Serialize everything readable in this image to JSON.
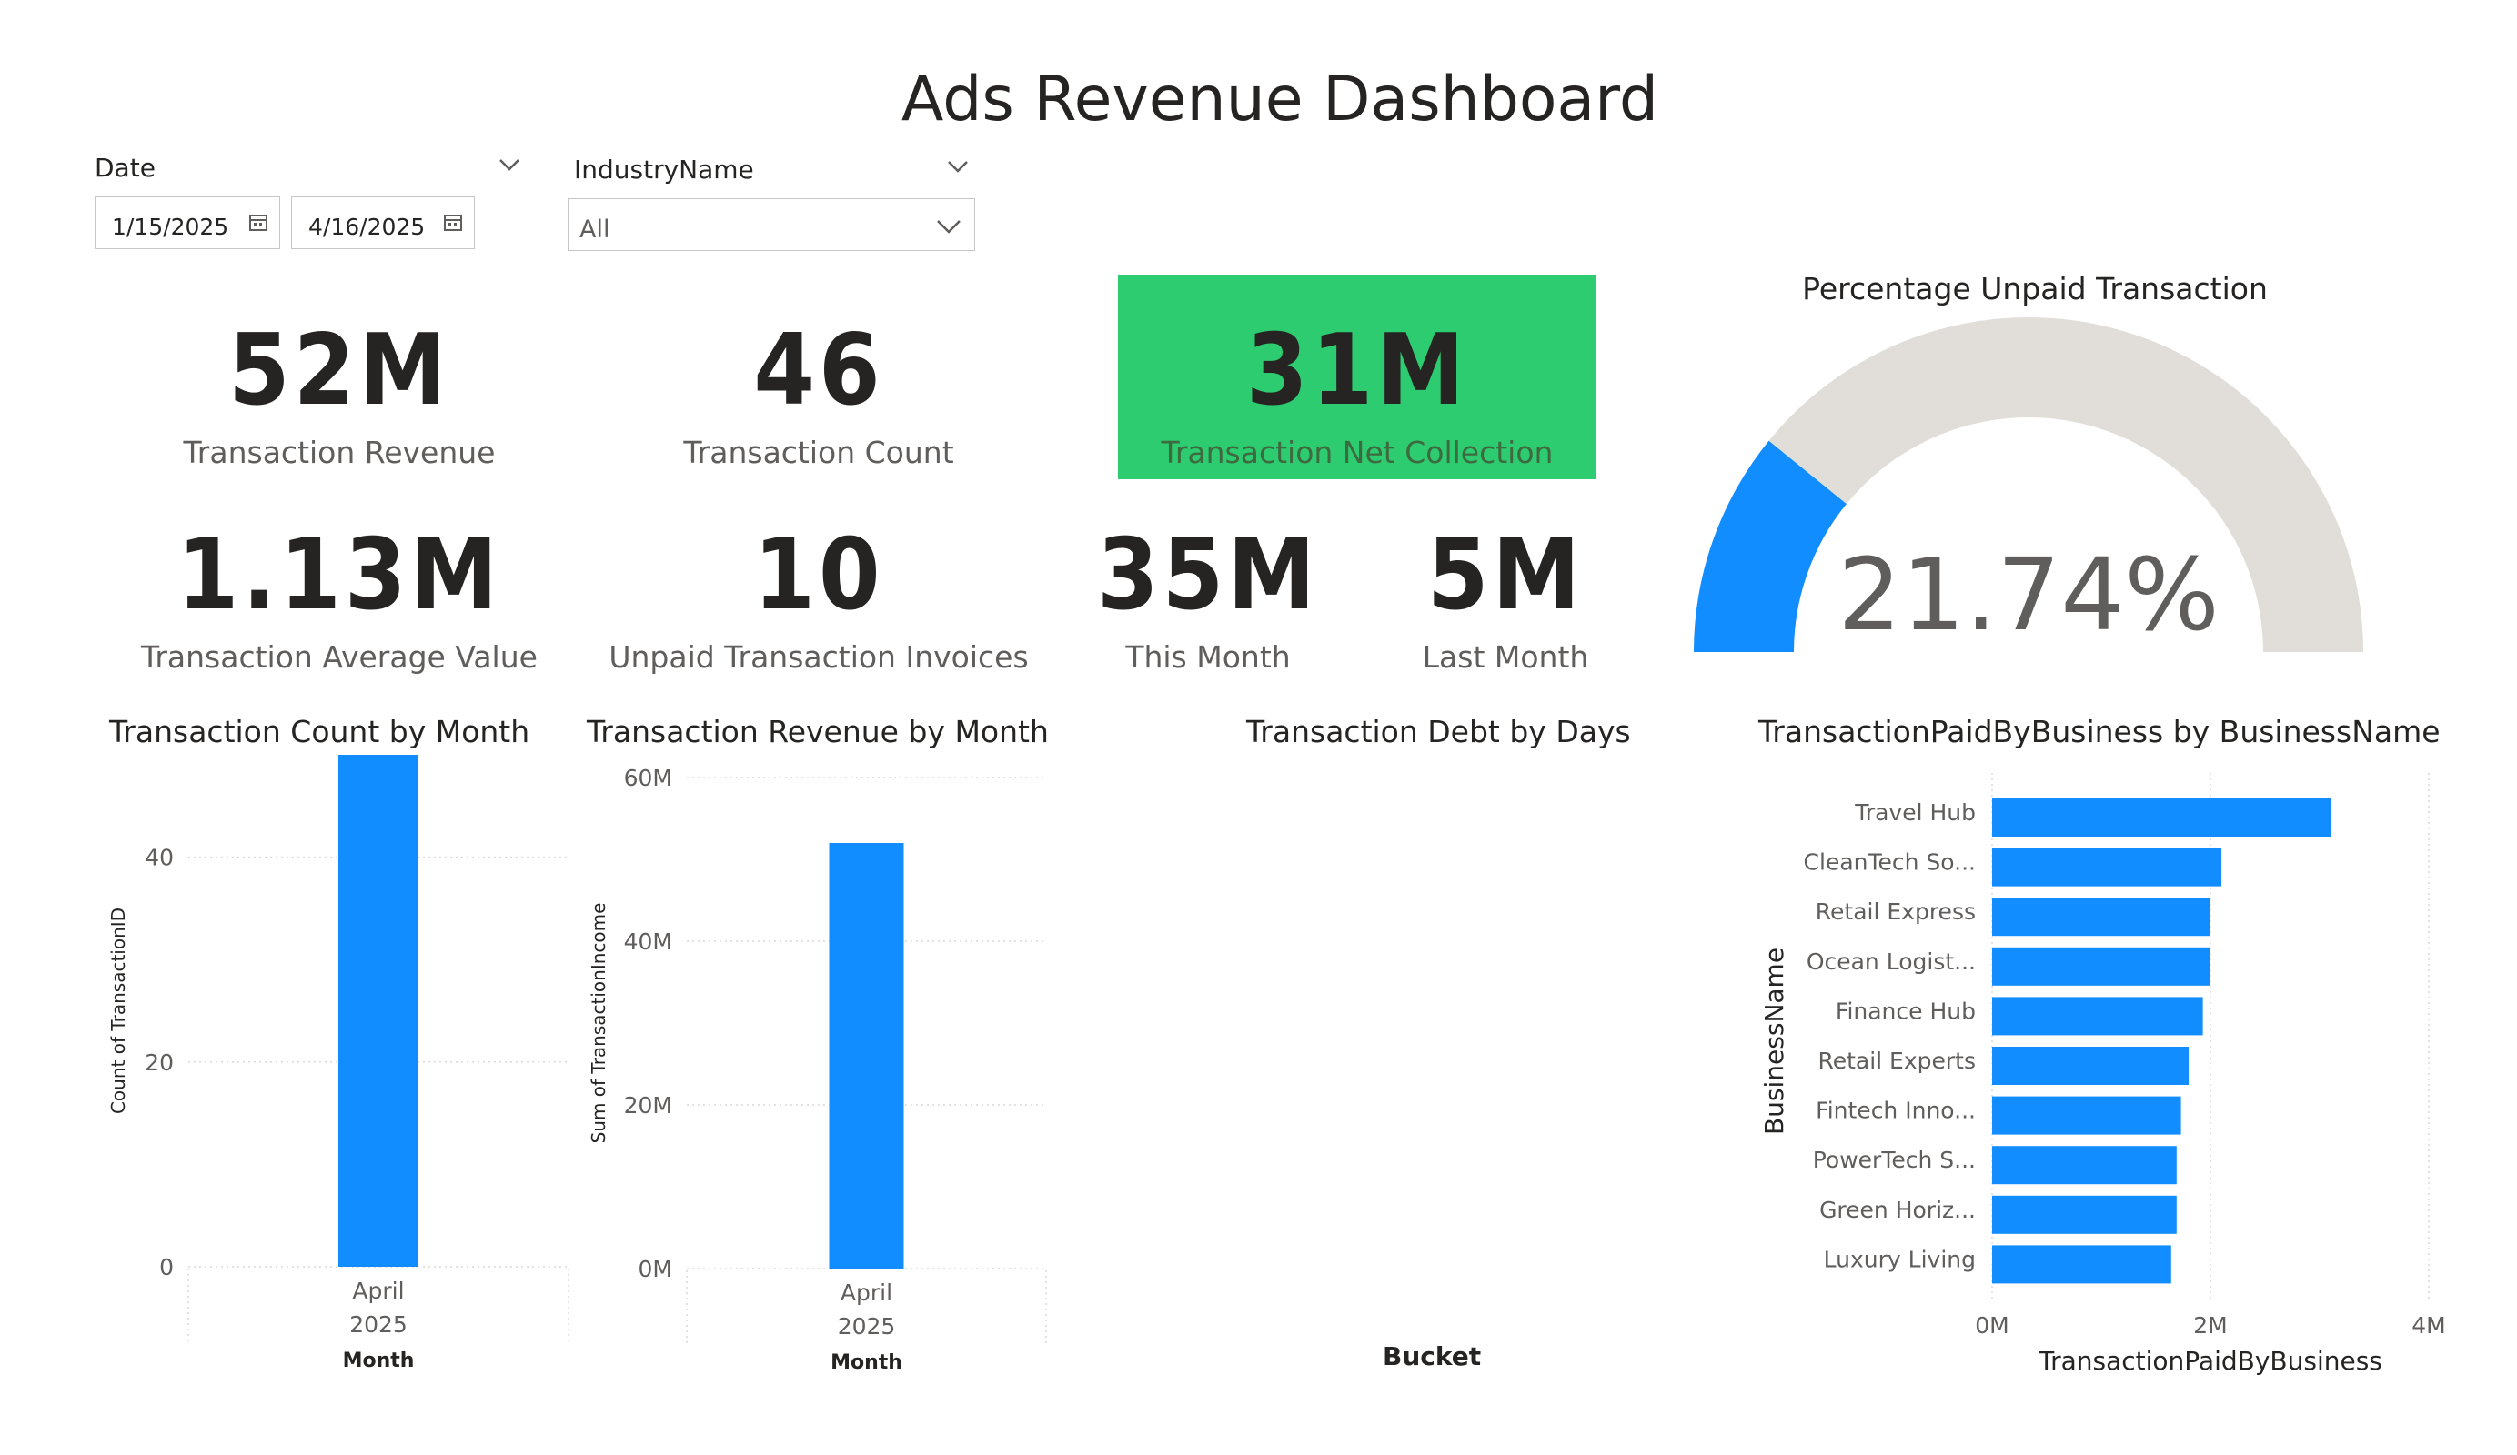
{
  "page": {
    "title": "Ads Revenue Dashboard"
  },
  "slicers": {
    "date": {
      "label": "Date",
      "start": "1/15/2025",
      "end": "4/16/2025"
    },
    "industry": {
      "label": "IndustryName",
      "value": "All"
    }
  },
  "kpis": {
    "revenue": {
      "value": "52M",
      "label": "Transaction Revenue"
    },
    "count": {
      "value": "46",
      "label": "Transaction Count"
    },
    "net_collection": {
      "value": "31M",
      "label": "Transaction Net Collection",
      "background": "#2ecc71"
    },
    "average": {
      "value": "1.13M",
      "label": "Transaction Average Value"
    },
    "unpaid_invoices": {
      "value": "10",
      "label": "Unpaid Transaction Invoices"
    },
    "this_month": {
      "value": "35M",
      "label": "This Month"
    },
    "last_month": {
      "value": "5M",
      "label": "Last Month"
    }
  },
  "colors": {
    "accent": "#118dff",
    "gauge_track": "#e1ddd8",
    "green": "#2ecc71"
  },
  "chart_data": [
    {
      "type": "gauge",
      "title": "Percentage Unpaid Transaction",
      "value": 21.74,
      "value_label": "21.74%",
      "min": 0,
      "max": 100
    },
    {
      "type": "bar",
      "title": "Transaction Count by Month",
      "categories": [
        "April 2025"
      ],
      "category_month": "April",
      "category_year": "2025",
      "values": [
        50
      ],
      "xlabel": "Month",
      "ylabel": "Count of TransactionID",
      "yticks": [
        "0",
        "20",
        "40"
      ],
      "ylim": [
        0,
        50
      ]
    },
    {
      "type": "bar",
      "title": "Transaction Revenue by Month",
      "categories": [
        "April 2025"
      ],
      "category_month": "April",
      "category_year": "2025",
      "values": [
        52000000
      ],
      "xlabel": "Month",
      "ylabel": "Sum of TransactionIncome",
      "yticks": [
        "0M",
        "20M",
        "40M",
        "60M"
      ],
      "ylim": [
        0,
        60000000
      ]
    },
    {
      "type": "bar",
      "title": "Transaction Debt by Days",
      "categories": [],
      "values": [],
      "xlabel": "Bucket"
    },
    {
      "type": "bar",
      "orientation": "horizontal",
      "title": "TransactionPaidByBusiness by BusinessName",
      "categories": [
        "Travel Hub",
        "CleanTech So...",
        "Retail Express",
        "Ocean Logist...",
        "Finance Hub",
        "Retail Experts",
        "Fintech Inno...",
        "PowerTech S...",
        "Green Horiz...",
        "Luxury Living"
      ],
      "values": [
        3.1,
        2.1,
        2.0,
        2.0,
        1.93,
        1.8,
        1.73,
        1.69,
        1.69,
        1.64
      ],
      "value_unit": "M",
      "xlabel": "TransactionPaidByBusiness",
      "ylabel": "BusinessName",
      "xticks": [
        "0M",
        "2M",
        "4M"
      ],
      "xlim": [
        0,
        4
      ]
    }
  ]
}
